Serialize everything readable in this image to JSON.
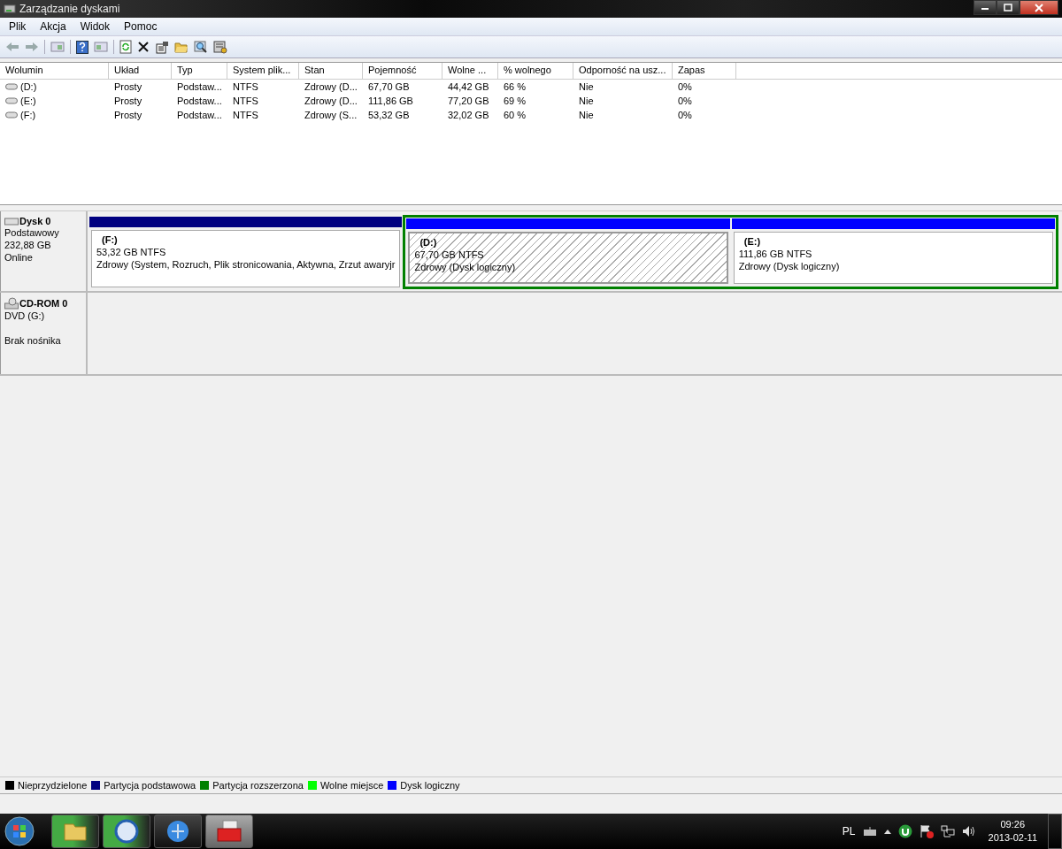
{
  "window": {
    "title": "Zarządzanie dyskami"
  },
  "menu": [
    "Plik",
    "Akcja",
    "Widok",
    "Pomoc"
  ],
  "table": {
    "columns": [
      "Wolumin",
      "Układ",
      "Typ",
      "System plik...",
      "Stan",
      "Pojemność",
      "Wolne ...",
      "% wolnego",
      "Odporność na usz...",
      "Zapas"
    ],
    "rows": [
      [
        "(D:)",
        "Prosty",
        "Podstaw...",
        "NTFS",
        "Zdrowy (D...",
        "67,70 GB",
        "44,42 GB",
        "66 %",
        "Nie",
        "0%"
      ],
      [
        "(E:)",
        "Prosty",
        "Podstaw...",
        "NTFS",
        "Zdrowy (D...",
        "111,86 GB",
        "77,20 GB",
        "69 %",
        "Nie",
        "0%"
      ],
      [
        "(F:)",
        "Prosty",
        "Podstaw...",
        "NTFS",
        "Zdrowy (S...",
        "53,32 GB",
        "32,02 GB",
        "60 %",
        "Nie",
        "0%"
      ]
    ]
  },
  "disks": [
    {
      "kind": "disk",
      "name": "Dysk 0",
      "lines": [
        "Podstawowy",
        "232,88 GB",
        "Online"
      ],
      "partitions": [
        {
          "kind": "primary",
          "color": "#000080",
          "selected": false,
          "label": "(F:)",
          "size": "53,32 GB NTFS",
          "status": "Zdrowy (System, Rozruch, Plik stronicowania, Aktywna, Zrzut awaryjr"
        },
        {
          "kind": "extended",
          "color": "#008000",
          "children": [
            {
              "color": "#0000ff",
              "selected": true,
              "label": "(D:)",
              "size": "67,70 GB NTFS",
              "status": "Zdrowy (Dysk logiczny)"
            },
            {
              "color": "#0000ff",
              "selected": false,
              "label": "(E:)",
              "size": "111,86 GB NTFS",
              "status": "Zdrowy (Dysk logiczny)"
            }
          ]
        }
      ]
    },
    {
      "kind": "cdrom",
      "name": "CD-ROM 0",
      "lines": [
        "DVD (G:)",
        "Brak nośnika"
      ]
    }
  ],
  "legend": [
    {
      "label": "Nieprzydzielone",
      "color": "#000000"
    },
    {
      "label": "Partycja podstawowa",
      "color": "#000080"
    },
    {
      "label": "Partycja rozszerzona",
      "color": "#008000"
    },
    {
      "label": "Wolne miejsce",
      "color": "#00ff00"
    },
    {
      "label": "Dysk logiczny",
      "color": "#0000ff"
    }
  ],
  "taskbar": {
    "language": "PL",
    "time": "09:26",
    "date": "2013-02-11"
  }
}
